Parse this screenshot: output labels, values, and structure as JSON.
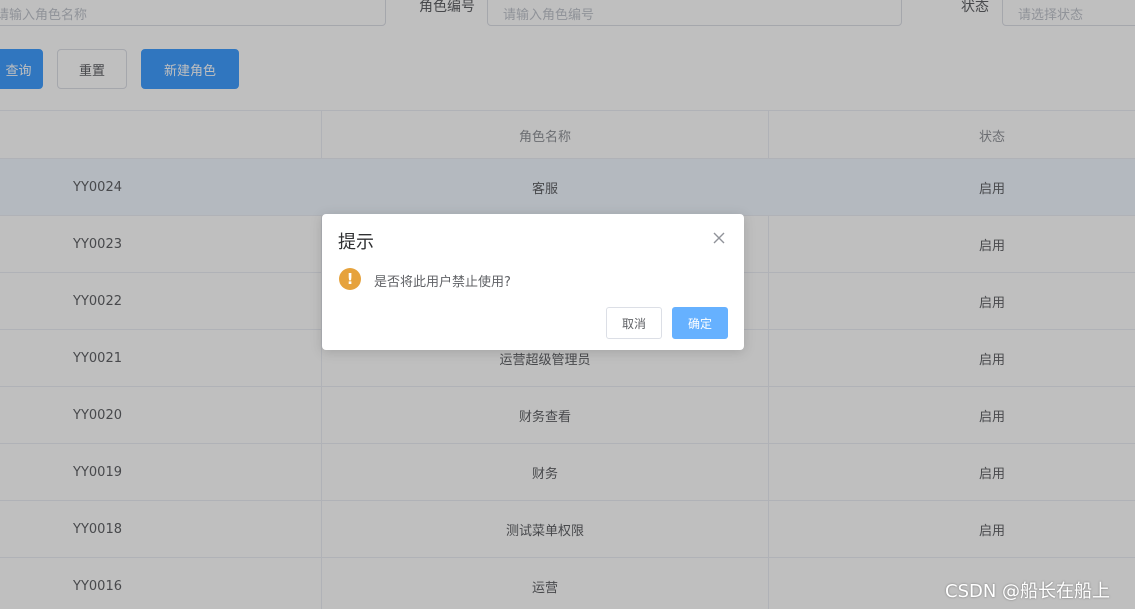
{
  "filters": {
    "role_name_placeholder": "请输入角色名称",
    "role_code_label": "角色编号",
    "role_code_placeholder": "请输入角色编号",
    "status_label": "状态",
    "status_placeholder": "请选择状态"
  },
  "toolbar": {
    "search_label": "查询",
    "reset_label": "重置",
    "new_role_label": "新建角色"
  },
  "table": {
    "headers": [
      "",
      "角色名称",
      "状态"
    ],
    "rows": [
      {
        "code": "YY0024",
        "name": "客服",
        "status": "启用"
      },
      {
        "code": "YY0023",
        "name": "",
        "status": "启用"
      },
      {
        "code": "YY0022",
        "name": "",
        "status": "启用"
      },
      {
        "code": "YY0021",
        "name": "运营超级管理员",
        "status": "启用"
      },
      {
        "code": "YY0020",
        "name": "财务查看",
        "status": "启用"
      },
      {
        "code": "YY0019",
        "name": "财务",
        "status": "启用"
      },
      {
        "code": "YY0018",
        "name": "测试菜单权限",
        "status": "启用"
      },
      {
        "code": "YY0016",
        "name": "运营",
        "status": ""
      }
    ]
  },
  "dialog": {
    "title": "提示",
    "message": "是否将此用户禁止使用?",
    "cancel_label": "取消",
    "confirm_label": "确定",
    "icon": "warning-icon"
  },
  "watermark": "CSDN @船长在船上",
  "colors": {
    "primary": "#409eff",
    "warning": "#e6a23c",
    "confirm_light": "#66b1ff"
  }
}
